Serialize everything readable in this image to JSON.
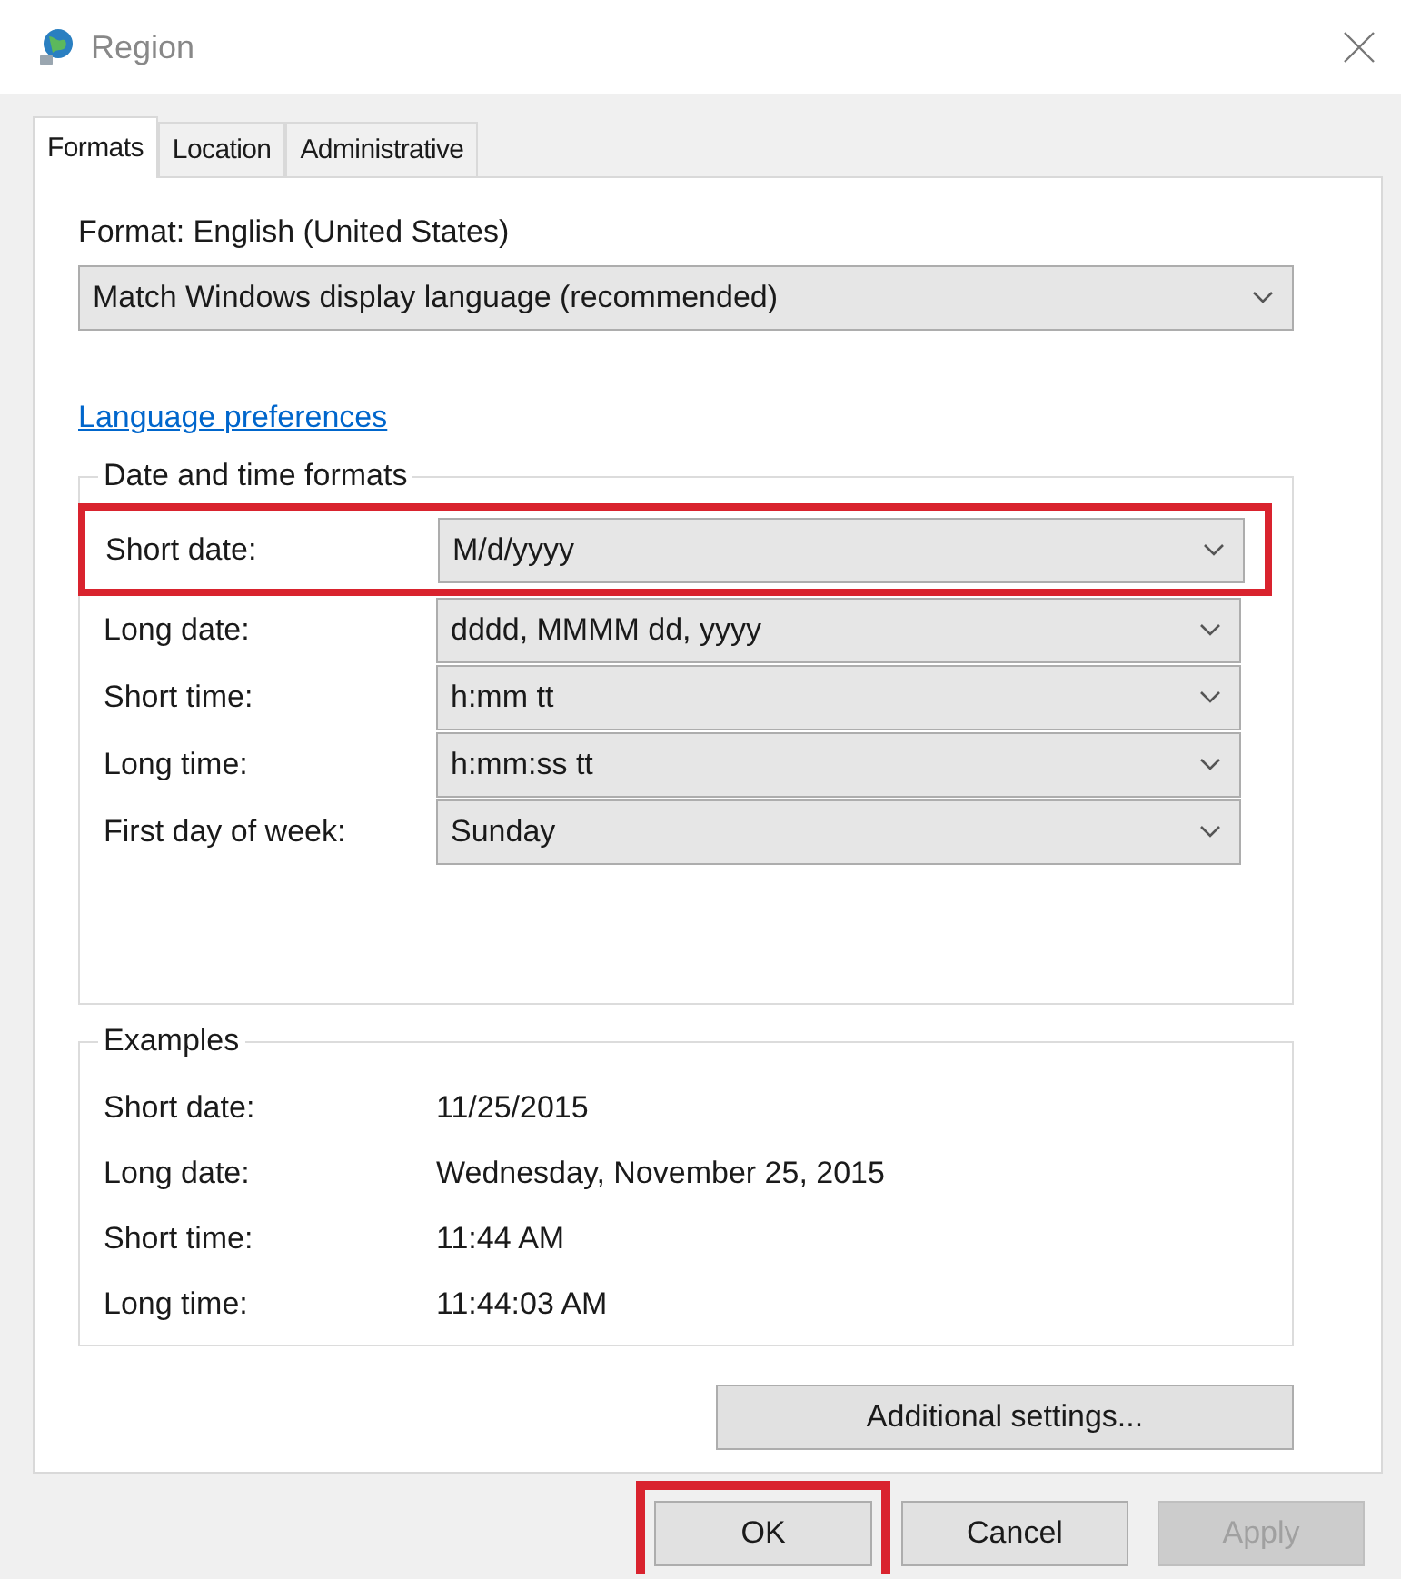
{
  "window": {
    "title": "Region"
  },
  "tabs": [
    {
      "label": "Formats",
      "selected": true
    },
    {
      "label": "Location",
      "selected": false
    },
    {
      "label": "Administrative",
      "selected": false
    }
  ],
  "format": {
    "label": "Format: English (United States)",
    "value": "Match Windows display language (recommended)"
  },
  "link": "Language preferences",
  "date_time_formats": {
    "title": "Date and time formats",
    "rows": [
      {
        "label": "Short date:",
        "value": "M/d/yyyy",
        "highlighted": true
      },
      {
        "label": "Long date:",
        "value": "dddd, MMMM dd, yyyy",
        "highlighted": false
      },
      {
        "label": "Short time:",
        "value": "h:mm tt",
        "highlighted": false
      },
      {
        "label": "Long time:",
        "value": "h:mm:ss tt",
        "highlighted": false
      },
      {
        "label": "First day of week:",
        "value": "Sunday",
        "highlighted": false
      }
    ]
  },
  "examples": {
    "title": "Examples",
    "rows": [
      {
        "label": "Short date:",
        "value": "11/25/2015"
      },
      {
        "label": "Long date:",
        "value": "Wednesday, November 25, 2015"
      },
      {
        "label": "Short time:",
        "value": "11:44 AM"
      },
      {
        "label": "Long time:",
        "value": "11:44:03 AM"
      }
    ]
  },
  "additional_button": "Additional settings...",
  "buttons": [
    {
      "label": "OK",
      "disabled": false,
      "highlighted": true
    },
    {
      "label": "Cancel",
      "disabled": false,
      "highlighted": false
    },
    {
      "label": "Apply",
      "disabled": true,
      "highlighted": false
    }
  ]
}
